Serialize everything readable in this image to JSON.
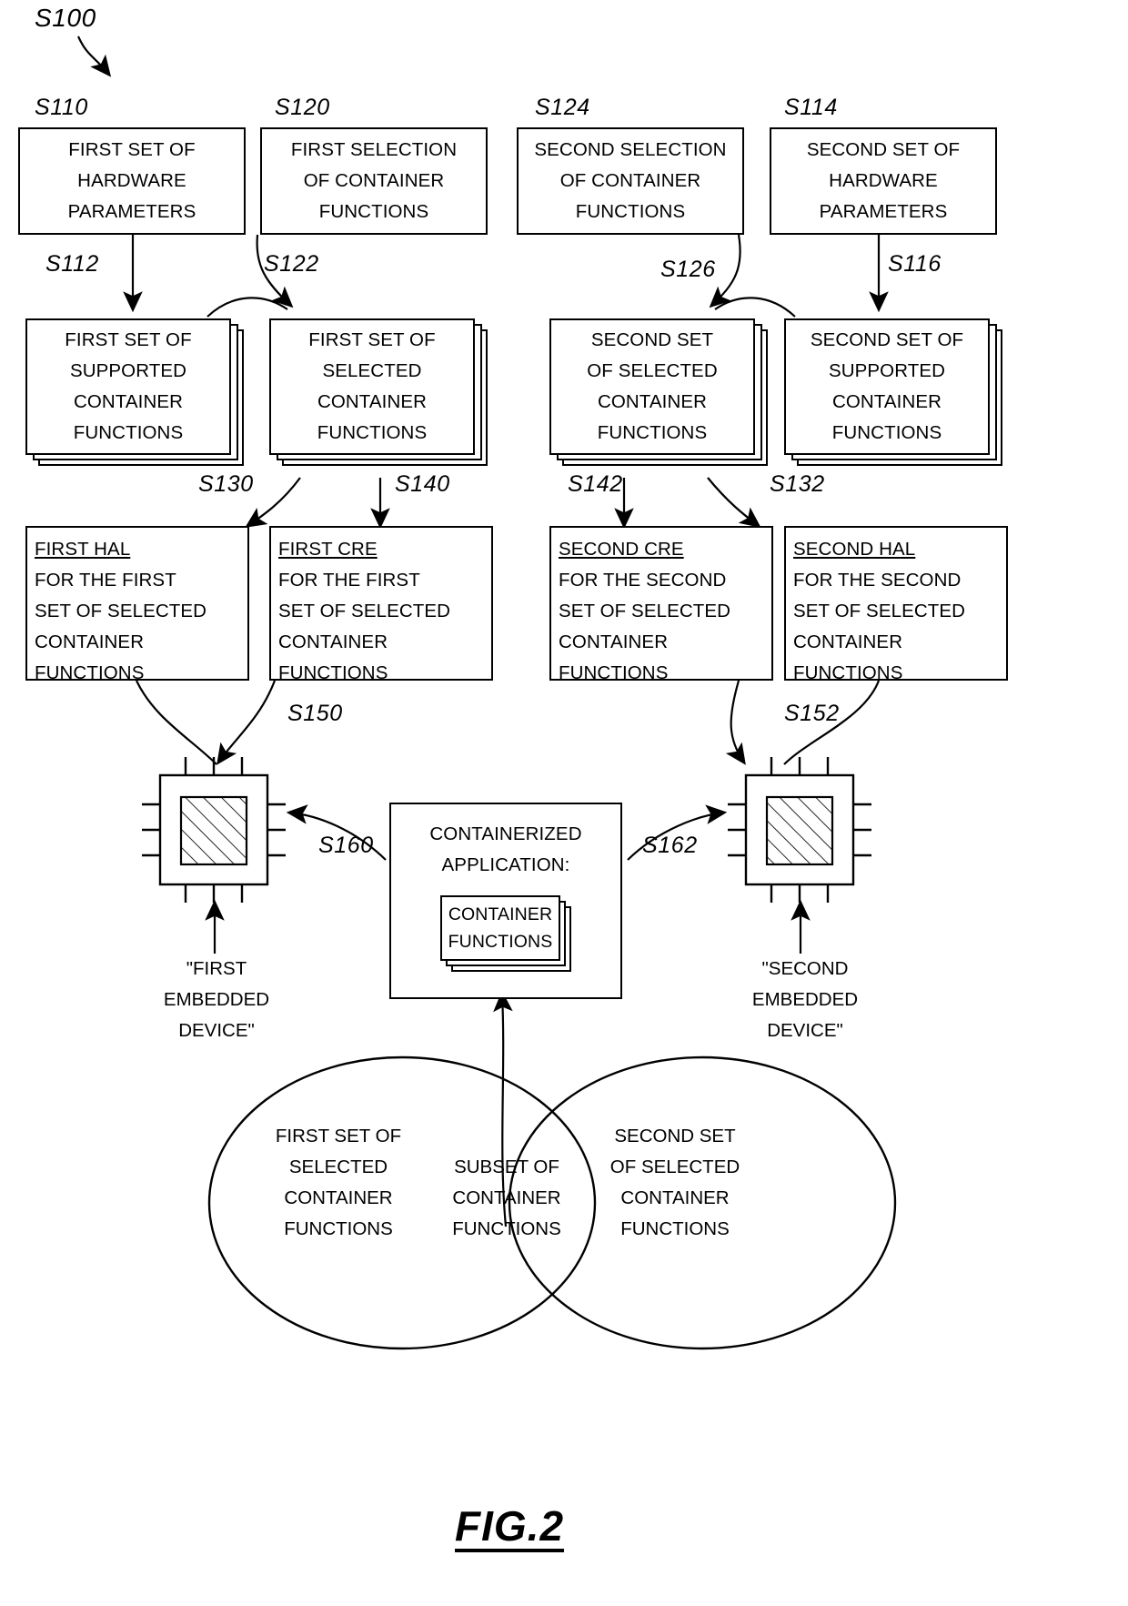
{
  "figure": {
    "id": "S100",
    "caption": "FIG.2"
  },
  "steps": {
    "s110": "S110",
    "s120": "S120",
    "s124": "S124",
    "s114": "S114",
    "s112": "S112",
    "s122": "S122",
    "s126": "S126",
    "s116": "S116",
    "s130": "S130",
    "s140": "S140",
    "s142": "S142",
    "s132": "S132",
    "s150": "S150",
    "s152": "S152",
    "s160": "S160",
    "s162": "S162"
  },
  "row1": [
    {
      "id": "S110",
      "lines": [
        "FIRST SET OF",
        "HARDWARE",
        "PARAMETERS"
      ]
    },
    {
      "id": "S120",
      "lines": [
        "FIRST SELECTION",
        "OF CONTAINER",
        "FUNCTIONS"
      ]
    },
    {
      "id": "S124",
      "lines": [
        "SECOND SELECTION",
        "OF CONTAINER",
        "FUNCTIONS"
      ]
    },
    {
      "id": "S114",
      "lines": [
        "SECOND SET OF",
        "HARDWARE",
        "PARAMETERS"
      ]
    }
  ],
  "row2": [
    {
      "lines": [
        "FIRST SET OF",
        "SUPPORTED",
        "CONTAINER",
        "FUNCTIONS"
      ]
    },
    {
      "lines": [
        "FIRST SET OF",
        "SELECTED",
        "CONTAINER",
        "FUNCTIONS"
      ]
    },
    {
      "lines": [
        "SECOND SET",
        "OF SELECTED",
        "CONTAINER",
        "FUNCTIONS"
      ]
    },
    {
      "lines": [
        "SECOND SET OF",
        "SUPPORTED",
        "CONTAINER",
        "FUNCTIONS"
      ]
    }
  ],
  "row3": [
    {
      "title": "FIRST HAL",
      "lines": [
        "FOR THE FIRST",
        "SET OF SELECTED",
        "CONTAINER",
        "FUNCTIONS"
      ]
    },
    {
      "title": "FIRST CRE",
      "lines": [
        "FOR THE FIRST",
        "SET OF SELECTED",
        "CONTAINER",
        "FUNCTIONS"
      ]
    },
    {
      "title": "SECOND CRE",
      "lines": [
        "FOR THE SECOND",
        "SET OF SELECTED",
        "CONTAINER",
        "FUNCTIONS"
      ]
    },
    {
      "title": "SECOND HAL",
      "lines": [
        "FOR THE SECOND",
        "SET OF SELECTED",
        "CONTAINER",
        "FUNCTIONS"
      ]
    }
  ],
  "devices": {
    "first_label": [
      "\"FIRST",
      "EMBEDDED",
      "DEVICE\""
    ],
    "second_label": [
      "\"SECOND",
      "EMBEDDED",
      "DEVICE\""
    ]
  },
  "app": {
    "title_lines": [
      "CONTAINERIZED",
      "APPLICATION:"
    ],
    "inner_lines": [
      "CONTAINER",
      "FUNCTIONS"
    ]
  },
  "venn": {
    "left": [
      "FIRST SET OF",
      "SELECTED",
      "CONTAINER",
      "FUNCTIONS"
    ],
    "center": [
      "SUBSET OF",
      "CONTAINER",
      "FUNCTIONS"
    ],
    "right": [
      "SECOND SET",
      "OF SELECTED",
      "CONTAINER",
      "FUNCTIONS"
    ]
  },
  "colors": {
    "ink": "#000000",
    "paper": "#ffffff"
  }
}
